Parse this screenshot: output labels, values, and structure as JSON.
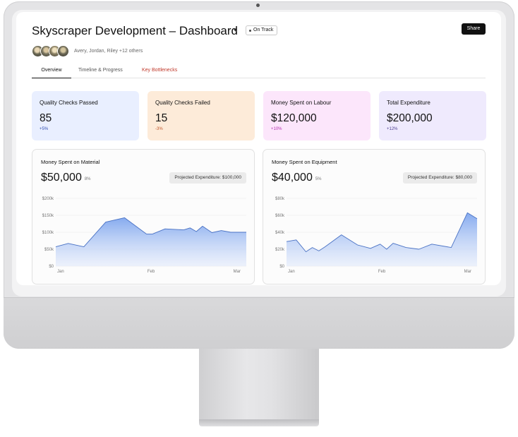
{
  "header": {
    "title": "Skyscraper Development – Dashboard",
    "caret": "▾",
    "status": "On Track",
    "share_label": "Share"
  },
  "collaborators": {
    "text": "Avery, Jordan, Riley +12 others"
  },
  "tabs": [
    {
      "label": "Overview",
      "active": true
    },
    {
      "label": "Timeline & Progress",
      "active": false
    },
    {
      "label": "Key Bottlenecks",
      "active": false
    }
  ],
  "stats": [
    {
      "label": "Quality Checks Passed",
      "value": "85",
      "delta": "+5%",
      "delta_color": "#2f4db0",
      "bg": "#e9efff"
    },
    {
      "label": "Quality Checks Failed",
      "value": "15",
      "delta": "-3%",
      "delta_color": "#c0562b",
      "bg": "#fdebd9"
    },
    {
      "label": "Money Spent on Labour",
      "value": "$120,000",
      "delta": "+10%",
      "delta_color": "#b42fb0",
      "bg": "#fce6fb"
    },
    {
      "label": "Total Expenditure",
      "value": "$200,000",
      "delta": "+12%",
      "delta_color": "#4b3b8f",
      "bg": "#efeafd"
    }
  ],
  "panels": {
    "material": {
      "title": "Money Spent on Material",
      "value": "$50,000",
      "pct": "8%",
      "projected": "Projected Expenditure: $100,000"
    },
    "equipment": {
      "title": "Money Spent on Equipment",
      "value": "$40,000",
      "pct": "5%",
      "projected": "Projected Expenditure: $80,000"
    }
  },
  "chart_data": [
    {
      "type": "area",
      "title": "Money Spent on Material",
      "x_ticks": [
        "Jan",
        "Feb",
        "Mar"
      ],
      "y_ticks": [
        "$0",
        "$50k",
        "$100k",
        "$150k",
        "$200k"
      ],
      "ylim": [
        0,
        200000
      ],
      "x": [
        1,
        5,
        10,
        17,
        23,
        30,
        32,
        36,
        42,
        44,
        46,
        48,
        51,
        54,
        57,
        62
      ],
      "values": [
        57000,
        67000,
        57000,
        130000,
        143000,
        95000,
        95000,
        110000,
        107000,
        113000,
        102000,
        118000,
        99000,
        105000,
        100000,
        100000
      ],
      "xlim": [
        1,
        62
      ],
      "grid": true,
      "color": "#4a72c4"
    },
    {
      "type": "area",
      "title": "Money Spent on Equipment",
      "x_ticks": [
        "Jan",
        "Feb",
        "Mar"
      ],
      "y_ticks": [
        "$0",
        "$20k",
        "$40k",
        "$60k",
        "$80k"
      ],
      "ylim": [
        0,
        80000
      ],
      "x": [
        1,
        4,
        7,
        9,
        11,
        13,
        18,
        23,
        27,
        30,
        32,
        34,
        38,
        42,
        46,
        52,
        57,
        60
      ],
      "values": [
        29000,
        31000,
        17000,
        22000,
        18000,
        23000,
        37000,
        25000,
        21000,
        26000,
        20000,
        27000,
        22000,
        20000,
        26000,
        22000,
        63000,
        56000
      ],
      "xlim": [
        1,
        60
      ],
      "grid": true,
      "color": "#4a72c4"
    }
  ]
}
